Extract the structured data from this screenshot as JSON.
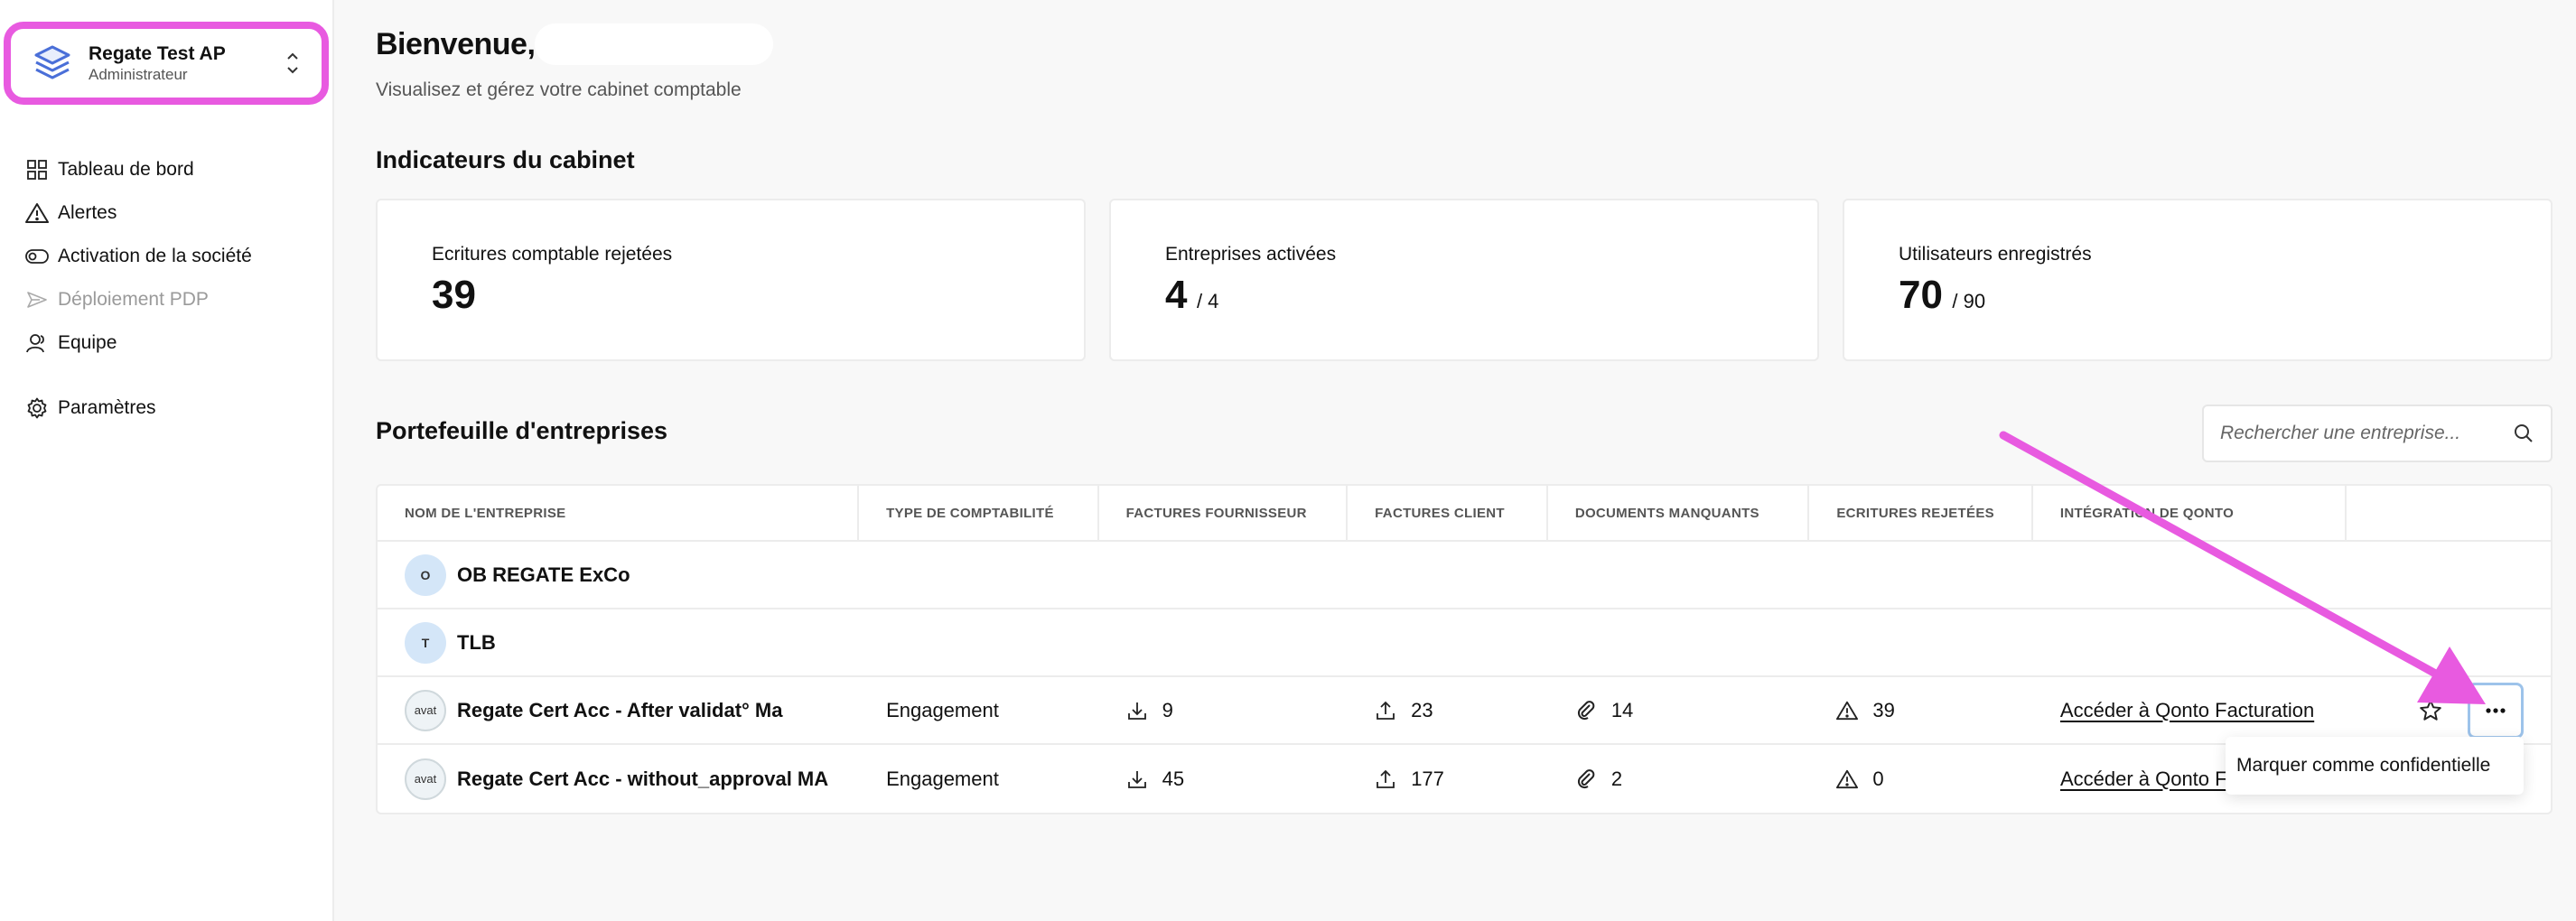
{
  "org": {
    "name": "Regate Test AP",
    "role": "Administrateur"
  },
  "nav": [
    {
      "label": "Tableau de bord",
      "icon": "dashboard-icon"
    },
    {
      "label": "Alertes",
      "icon": "warning-icon"
    },
    {
      "label": "Activation de la société",
      "icon": "toggle-icon"
    },
    {
      "label": "Déploiement PDP",
      "icon": "send-icon"
    },
    {
      "label": "Equipe",
      "icon": "team-icon"
    },
    {
      "label": "Paramètres",
      "icon": "gear-icon"
    }
  ],
  "header": {
    "title": "Bienvenue,",
    "subtitle": "Visualisez et gérez votre cabinet comptable"
  },
  "indicators": {
    "title": "Indicateurs du cabinet",
    "cards": [
      {
        "label": "Ecritures comptable rejetées",
        "value": "39",
        "total": ""
      },
      {
        "label": "Entreprises activées",
        "value": "4",
        "total": "/ 4"
      },
      {
        "label": "Utilisateurs enregistrés",
        "value": "70",
        "total": "/ 90"
      }
    ]
  },
  "portfolio": {
    "title": "Portefeuille d'entreprises",
    "search_placeholder": "Rechercher une entreprise...",
    "columns": [
      "Nom de l'entreprise",
      "Type de comptabilité",
      "Factures fournisseur",
      "Factures client",
      "Documents manquants",
      "Ecritures rejetées",
      "Intégration de Qonto",
      ""
    ],
    "rows": [
      {
        "avatar": "O",
        "name": "OB REGATE ExCo",
        "type": "",
        "supplier": "",
        "client": "",
        "missing": "",
        "rejected": "",
        "integration": ""
      },
      {
        "avatar": "T",
        "name": "TLB",
        "type": "",
        "supplier": "",
        "client": "",
        "missing": "",
        "rejected": "",
        "integration": ""
      },
      {
        "avatar": "avat",
        "name": "Regate Cert Acc - After validat° Ma",
        "type": "Engagement",
        "supplier": "9",
        "client": "23",
        "missing": "14",
        "rejected": "39",
        "integration": "Accéder à Qonto Facturation"
      },
      {
        "avatar": "avat",
        "name": "Regate Cert Acc - without_approval MA",
        "type": "Engagement",
        "supplier": "45",
        "client": "177",
        "missing": "2",
        "rejected": "0",
        "integration": "Accéder à Qonto F"
      }
    ]
  },
  "menu": {
    "item": "Marquer comme confidentielle"
  },
  "colors": {
    "highlight": "#e85ae0",
    "focus": "#9dc3ea",
    "avatar_bg": "#d4e6f8"
  }
}
